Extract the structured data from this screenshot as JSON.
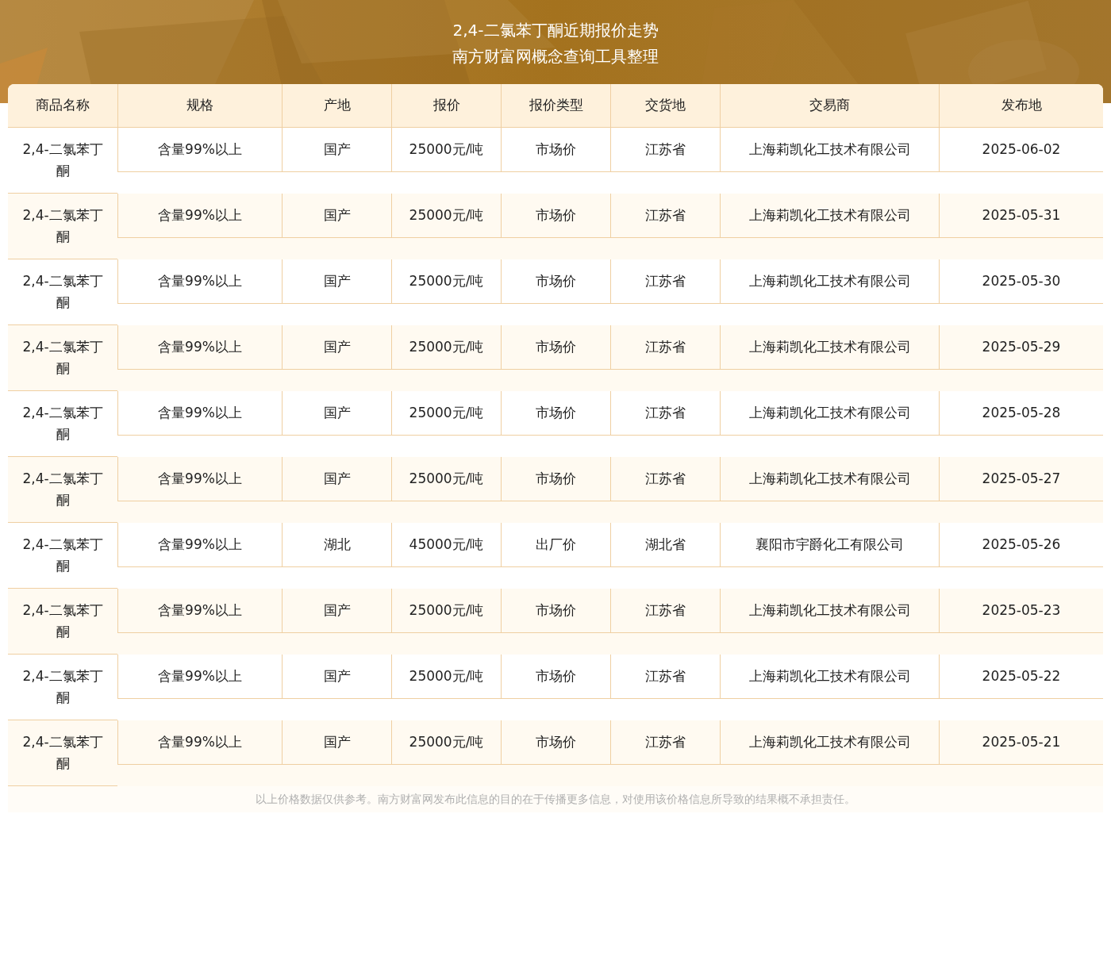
{
  "header": {
    "title": "2,4-二氯苯丁酮近期报价走势",
    "subtitle": "南方财富网概念查询工具整理"
  },
  "table": {
    "columns": [
      "商品名称",
      "规格",
      "产地",
      "报价",
      "报价类型",
      "交货地",
      "交易商",
      "发布地"
    ],
    "rows": [
      [
        "2,4-二氯苯丁酮",
        "含量99%以上",
        "国产",
        "25000元/吨",
        "市场价",
        "江苏省",
        "上海莉凯化工技术有限公司",
        "2025-06-02"
      ],
      [
        "2,4-二氯苯丁酮",
        "含量99%以上",
        "国产",
        "25000元/吨",
        "市场价",
        "江苏省",
        "上海莉凯化工技术有限公司",
        "2025-05-31"
      ],
      [
        "2,4-二氯苯丁酮",
        "含量99%以上",
        "国产",
        "25000元/吨",
        "市场价",
        "江苏省",
        "上海莉凯化工技术有限公司",
        "2025-05-30"
      ],
      [
        "2,4-二氯苯丁酮",
        "含量99%以上",
        "国产",
        "25000元/吨",
        "市场价",
        "江苏省",
        "上海莉凯化工技术有限公司",
        "2025-05-29"
      ],
      [
        "2,4-二氯苯丁酮",
        "含量99%以上",
        "国产",
        "25000元/吨",
        "市场价",
        "江苏省",
        "上海莉凯化工技术有限公司",
        "2025-05-28"
      ],
      [
        "2,4-二氯苯丁酮",
        "含量99%以上",
        "国产",
        "25000元/吨",
        "市场价",
        "江苏省",
        "上海莉凯化工技术有限公司",
        "2025-05-27"
      ],
      [
        "2,4-二氯苯丁酮",
        "含量99%以上",
        "湖北",
        "45000元/吨",
        "出厂价",
        "湖北省",
        "襄阳市宇爵化工有限公司",
        "2025-05-26"
      ],
      [
        "2,4-二氯苯丁酮",
        "含量99%以上",
        "国产",
        "25000元/吨",
        "市场价",
        "江苏省",
        "上海莉凯化工技术有限公司",
        "2025-05-23"
      ],
      [
        "2,4-二氯苯丁酮",
        "含量99%以上",
        "国产",
        "25000元/吨",
        "市场价",
        "江苏省",
        "上海莉凯化工技术有限公司",
        "2025-05-22"
      ],
      [
        "2,4-二氯苯丁酮",
        "含量99%以上",
        "国产",
        "25000元/吨",
        "市场价",
        "江苏省",
        "上海莉凯化工技术有限公司",
        "2025-05-21"
      ]
    ]
  },
  "footer_note": "以上价格数据仅供参考。南方财富网发布此信息的目的在于传播更多信息，对使用该价格信息所导致的结果概不承担责任。"
}
